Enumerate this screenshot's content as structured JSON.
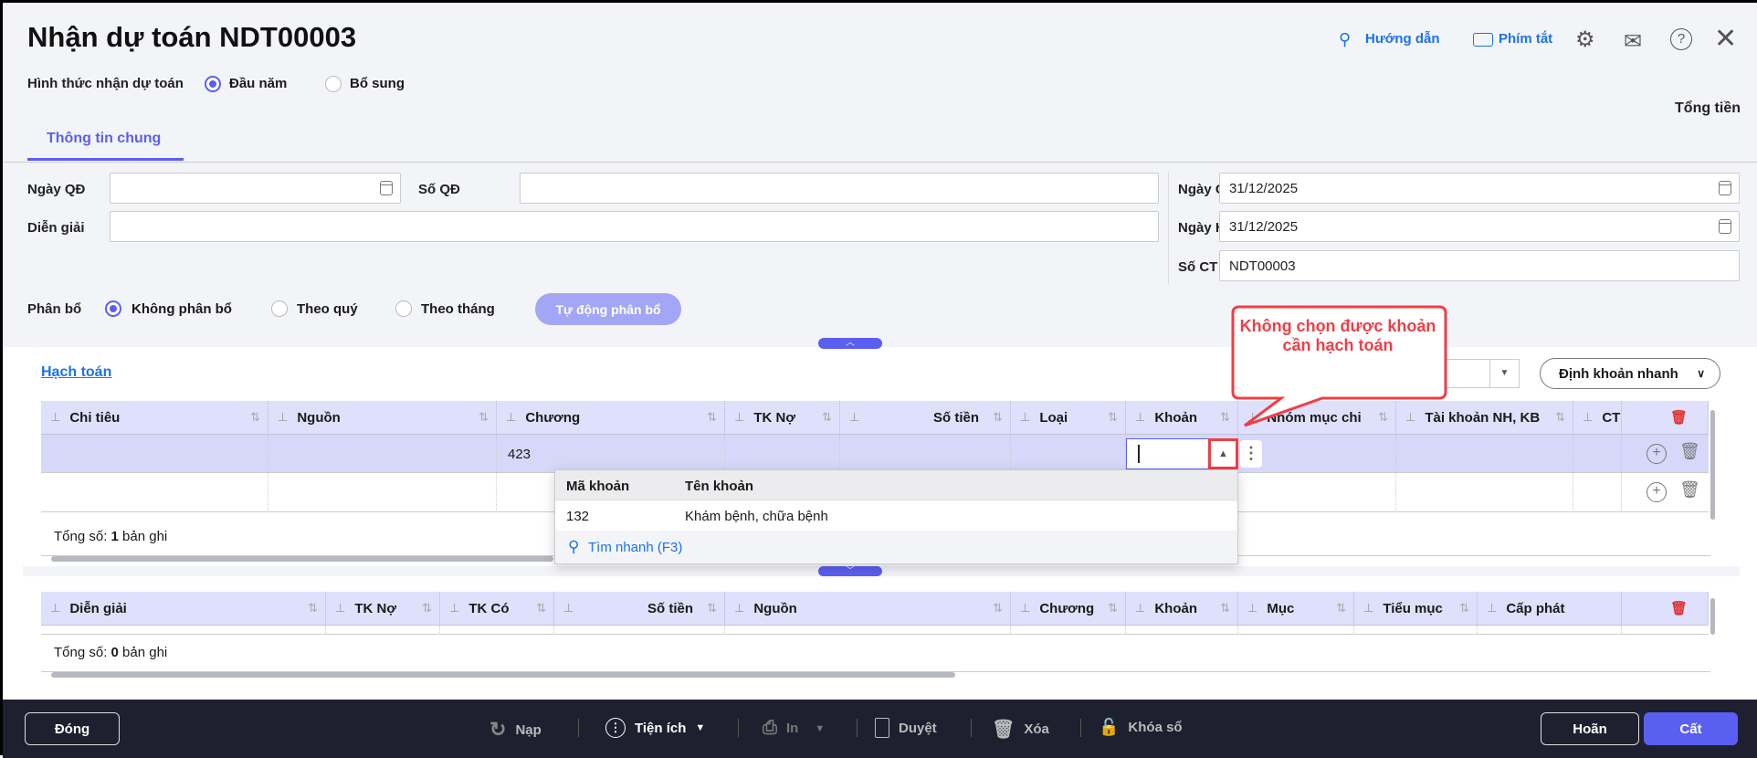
{
  "title": "Nhận dự toán NDT00003",
  "header_links": {
    "guide": "Hướng dẫn",
    "shortcuts": "Phím tắt"
  },
  "receive_type": {
    "label": "Hình thức nhận dự toán",
    "options": [
      "Đầu năm",
      "Bổ sung"
    ],
    "selected": "Đầu năm"
  },
  "total_label": "Tổng tiền",
  "tabs": [
    "Thông tin chung"
  ],
  "form": {
    "ngay_qd_label": "Ngày QĐ",
    "ngay_qd": "",
    "so_qd_label": "Số QĐ",
    "so_qd": "",
    "dien_giai_label": "Diễn giải",
    "dien_giai": "",
    "ngay_ct_label": "Ngày CT",
    "ngay_ct": "31/12/2025",
    "ngay_ht_label": "Ngày HT",
    "ngay_ht": "31/12/2025",
    "so_ct_label": "Số CT",
    "so_ct": "NDT00003"
  },
  "allocation": {
    "label": "Phân bổ",
    "options": [
      "Không phân bổ",
      "Theo quý",
      "Theo tháng"
    ],
    "selected": "Không phân bổ",
    "auto_button": "Tự động phân bổ"
  },
  "accounting": {
    "link": "Hạch toán",
    "quick_button": "Định khoản nhanh",
    "columns": [
      "Chi tiêu",
      "Nguồn",
      "Chương",
      "TK Nợ",
      "Số tiền",
      "Loại",
      "Khoản",
      "Nhóm mục chi",
      "Tài khoản NH, KB",
      "CT"
    ],
    "rows": [
      [
        "",
        "",
        "423",
        "",
        "",
        "",
        "",
        "",
        "",
        ""
      ]
    ],
    "total_prefix": "Tổng số: ",
    "total_count": "1",
    "total_suffix": " bản ghi"
  },
  "dropdown": {
    "headers": [
      "Mã khoản",
      "Tên khoản"
    ],
    "items": [
      {
        "code": "132",
        "name": "Khám bệnh, chữa bệnh"
      }
    ],
    "search": "Tìm nhanh (F3)"
  },
  "callout": "Không chọn được khoản cần hạch toán",
  "detail": {
    "columns": [
      "Diễn giải",
      "TK Nợ",
      "TK Có",
      "Số tiền",
      "Nguồn",
      "Chương",
      "Khoản",
      "Mục",
      "Tiểu mục",
      "Cấp phát"
    ],
    "total_prefix": "Tổng số: ",
    "total_count": "0",
    "total_suffix": " bản ghi"
  },
  "footer": {
    "close": "Đóng",
    "reload": "Nạp",
    "utilities": "Tiện ích",
    "print": "In",
    "approve": "Duyệt",
    "delete": "Xóa",
    "lock": "Khóa sổ",
    "defer": "Hoãn",
    "save": "Cất"
  },
  "colors": {
    "accent": "#5b5fef",
    "callout": "#ef3e46",
    "link": "#1a73e8",
    "footer": "#1e2030"
  }
}
